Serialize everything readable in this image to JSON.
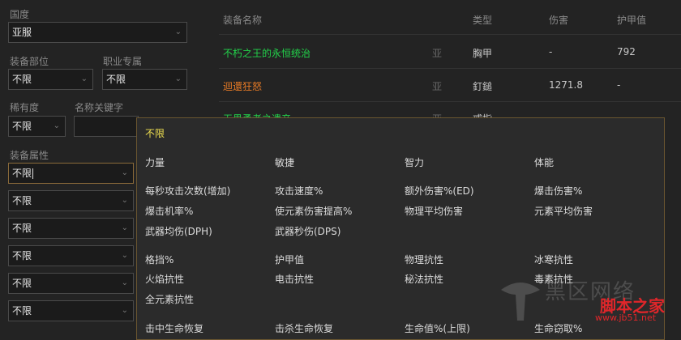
{
  "filters": {
    "guodu_label": "国度",
    "guodu_value": "亚服",
    "slot_label": "装备部位",
    "slot_value": "不限",
    "class_label": "职业专属",
    "class_value": "不限",
    "rarity_label": "稀有度",
    "rarity_value": "不限",
    "keyword_label": "名称关键字",
    "keyword_value": "",
    "attr_label": "装备属性",
    "attr_values": [
      "不限",
      "不限",
      "不限",
      "不限",
      "不限",
      "不限"
    ]
  },
  "table": {
    "headers": {
      "name": "装备名称",
      "type": "类型",
      "damage": "伤害",
      "armor": "护甲值"
    },
    "rows": [
      {
        "name": "不朽之王的永恒统治",
        "region": "亚",
        "type": "胸甲",
        "damage": "-",
        "armor": "792"
      },
      {
        "name": "迴還狂怒",
        "region": "亚",
        "type": "釘鎚",
        "damage": "1271.8",
        "armor": "-"
      },
      {
        "name": "无畏勇者之遗产",
        "region": "亚",
        "type": "戒指",
        "damage": "",
        "armor": ""
      }
    ]
  },
  "dropdown": {
    "selected": "不限",
    "groups": [
      [
        "力量",
        "敏捷",
        "智力",
        "体能"
      ],
      [
        "每秒攻击次数(增加)",
        "攻击速度%",
        "额外伤害%(ED)",
        "爆击伤害%"
      ],
      [
        "爆击机率%",
        "使元素伤害提高%",
        "物理平均伤害",
        "元素平均伤害"
      ],
      [
        "武器均伤(DPH)",
        "武器秒伤(DPS)",
        "",
        ""
      ],
      [
        "格挡%",
        "护甲值",
        "物理抗性",
        "冰寒抗性"
      ],
      [
        "火焰抗性",
        "电击抗性",
        "秘法抗性",
        "毒素抗性"
      ],
      [
        "全元素抗性",
        "",
        "",
        ""
      ],
      [
        "击中生命恢复",
        "击杀生命恢复",
        "生命值%(上限)",
        "生命窃取%"
      ]
    ]
  },
  "watermark": {
    "line1": "黑区网络",
    "line2": "脚本之家",
    "line3": "www.jb51.net"
  },
  "colors": {
    "legendary": "#22d34a",
    "set_orange": "#e87b26",
    "selected_yellow": "#f0e050"
  }
}
